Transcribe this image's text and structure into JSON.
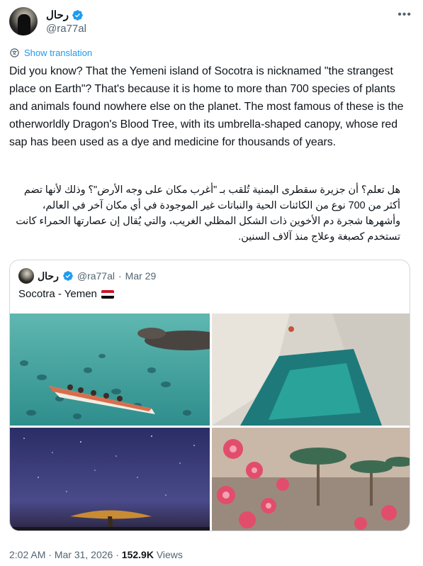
{
  "tweet": {
    "author": {
      "display_name": "رحال",
      "handle": "@ra77al",
      "verified": true
    },
    "translate_label": "Show translation",
    "body_en": "Did you know? That the Yemeni island of Socotra is nicknamed \"the strangest place on Earth\"? That's because it is home to more than 700 species of plants and animals found nowhere else on the planet. The most famous of these is the otherworldly Dragon's Blood Tree, with its umbrella-shaped canopy, whose red sap has been used as a dye and medicine for thousands of years.",
    "body_ar": "هل تعلم؟ أن جزيرة سقطرى اليمنية تُلقب بـ \"أغرب مكان على وجه الأرض\"؟ وذلك لأنها تضم أكثر من 700 نوع من الكائنات الحية والنباتات غير الموجودة في أي مكان آخر في العالم، وأشهرها شجرة دم الأخوين ذات الشكل المظلي الغريب، والتي يُقال إن عصارتها الحمراء كانت تستخدم كصبغة وعلاج منذ آلاف السنين.",
    "quote": {
      "display_name": "رحال",
      "handle": "@ra77al",
      "date": "Mar 29",
      "separator": "·",
      "text": "Socotra - Yemen",
      "flag_colors": [
        "#ce1126",
        "#ffffff",
        "#000000"
      ]
    },
    "footer": {
      "time": "2:02 AM",
      "date": "Mar 31, 2026",
      "views_count": "152.9K",
      "views_label": "Views",
      "separator": "·"
    }
  },
  "icons": {
    "more": "more-horizontal-icon",
    "verified": "verified-badge-icon",
    "translate": "globe-translate-icon"
  },
  "colors": {
    "accent": "#1d9bf0",
    "text": "#0f1419",
    "muted": "#536471",
    "border": "#cfd9de"
  }
}
